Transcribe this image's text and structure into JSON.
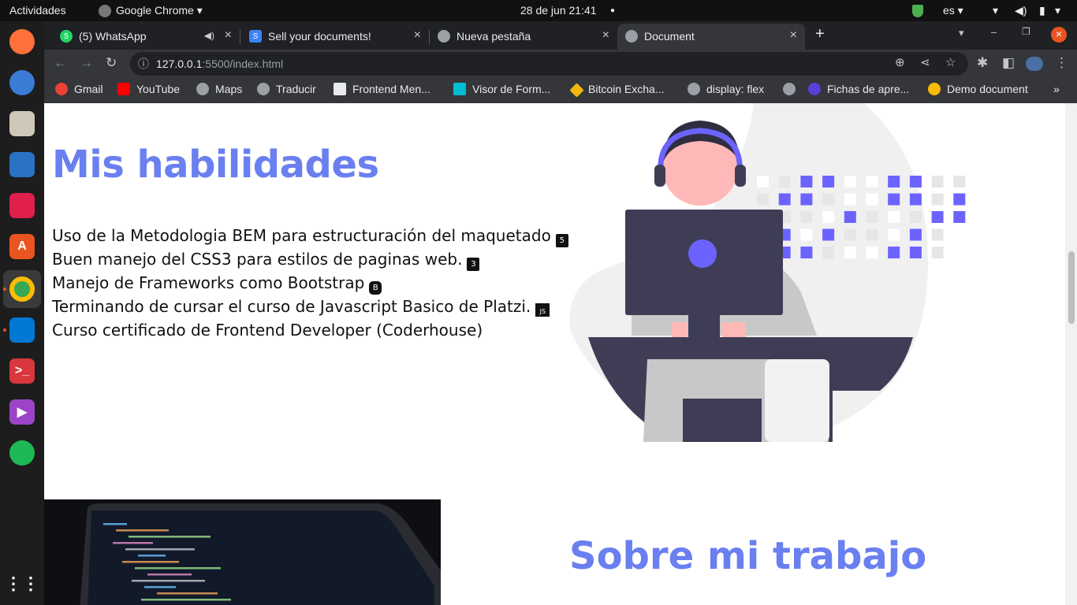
{
  "system": {
    "activities": "Actividades",
    "app_name": "Google Chrome",
    "datetime": "28 de jun  21:41",
    "lang": "es"
  },
  "tabs": [
    {
      "title": "(5) WhatsApp",
      "active": false
    },
    {
      "title": "Sell your documents!",
      "active": false
    },
    {
      "title": "Nueva pestaña",
      "active": false
    },
    {
      "title": "Document",
      "active": true
    }
  ],
  "address": {
    "host": "127.0.0.1",
    "path": ":5500/index.html"
  },
  "bookmarks": [
    {
      "label": "Gmail",
      "color": "#ea4335"
    },
    {
      "label": "YouTube",
      "color": "#ff0000"
    },
    {
      "label": "Maps",
      "color": "#9aa0a6"
    },
    {
      "label": "Traducir",
      "color": "#9aa0a6"
    },
    {
      "label": "Frontend Men...",
      "color": "#e8eaed"
    },
    {
      "label": "Visor de Form...",
      "color": "#00bcd4"
    },
    {
      "label": "Bitcoin Excha...",
      "color": "#f0b90b"
    },
    {
      "label": "display: flex",
      "color": "#9aa0a6"
    },
    {
      "label": "",
      "color": "#9aa0a6"
    },
    {
      "label": "Fichas de apre...",
      "color": "#5b3fd6"
    },
    {
      "label": "Demo document",
      "color": "#fbbc04"
    }
  ],
  "page": {
    "skills_title": "Mis habilidades",
    "skills": [
      {
        "text": "Uso de la Metodologia BEM para estructuración del maquetado",
        "icon": "5"
      },
      {
        "text": "Buen manejo del CSS3 para estilos de paginas web.",
        "icon": "3"
      },
      {
        "text": "Manejo de Frameworks como Bootstrap",
        "icon": "B"
      },
      {
        "text": "Terminando de cursar el curso de Javascript Basico de Platzi.",
        "icon": "JS"
      },
      {
        "text": "Curso certificado de Frontend Developer (Coderhouse)",
        "icon": ""
      }
    ],
    "work_title": "Sobre mi trabajo"
  },
  "colors": {
    "accent": "#6a7ff0",
    "illustration_purple": "#6c63ff",
    "illustration_dark": "#3f3d56"
  }
}
